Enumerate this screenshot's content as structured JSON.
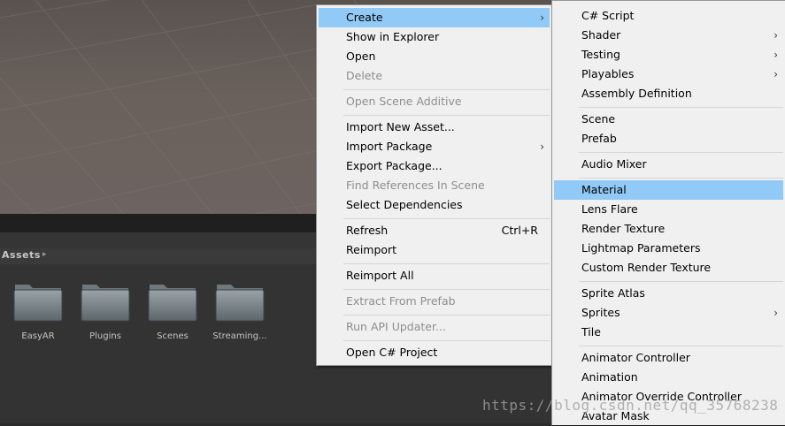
{
  "context_menu": {
    "items": [
      {
        "label": "Create",
        "highlighted": true,
        "submenu": true
      },
      {
        "label": "Show in Explorer"
      },
      {
        "label": "Open"
      },
      {
        "label": "Delete",
        "disabled": true
      },
      {
        "label": "Open Scene Additive",
        "disabled": true
      },
      {
        "label": "Import New Asset..."
      },
      {
        "label": "Import Package",
        "submenu": true
      },
      {
        "label": "Export Package..."
      },
      {
        "label": "Find References In Scene",
        "disabled": true
      },
      {
        "label": "Select Dependencies"
      },
      {
        "label": "Refresh",
        "shortcut": "Ctrl+R"
      },
      {
        "label": "Reimport"
      },
      {
        "label": "Reimport All"
      },
      {
        "label": "Extract From Prefab",
        "disabled": true
      },
      {
        "label": "Run API Updater...",
        "disabled": true
      },
      {
        "label": "Open C# Project"
      }
    ]
  },
  "create_submenu": {
    "items": [
      {
        "label": "C# Script"
      },
      {
        "label": "Shader",
        "submenu": true
      },
      {
        "label": "Testing",
        "submenu": true
      },
      {
        "label": "Playables",
        "submenu": true
      },
      {
        "label": "Assembly Definition"
      },
      {
        "label": "Scene"
      },
      {
        "label": "Prefab"
      },
      {
        "label": "Audio Mixer"
      },
      {
        "label": "Material",
        "highlighted": true
      },
      {
        "label": "Lens Flare"
      },
      {
        "label": "Render Texture"
      },
      {
        "label": "Lightmap Parameters"
      },
      {
        "label": "Custom Render Texture"
      },
      {
        "label": "Sprite Atlas"
      },
      {
        "label": "Sprites",
        "submenu": true
      },
      {
        "label": "Tile"
      },
      {
        "label": "Animator Controller"
      },
      {
        "label": "Animation"
      },
      {
        "label": "Animator Override Controller"
      },
      {
        "label": "Avatar Mask"
      }
    ]
  },
  "project": {
    "breadcrumb": "Assets",
    "breadcrumb_arrow": "▸",
    "folders": [
      {
        "name": "EasyAR"
      },
      {
        "name": "Plugins"
      },
      {
        "name": "Scenes"
      },
      {
        "name": "Streaming..."
      }
    ]
  },
  "submenu_arrow": "›",
  "watermark": "https://blog.csdn.net/qq_35768238",
  "colors": {
    "highlight": "#91c9f7",
    "menu_bg": "#f0f0f0",
    "disabled_text": "#8e8e8e",
    "panel_bg": "#333333"
  }
}
